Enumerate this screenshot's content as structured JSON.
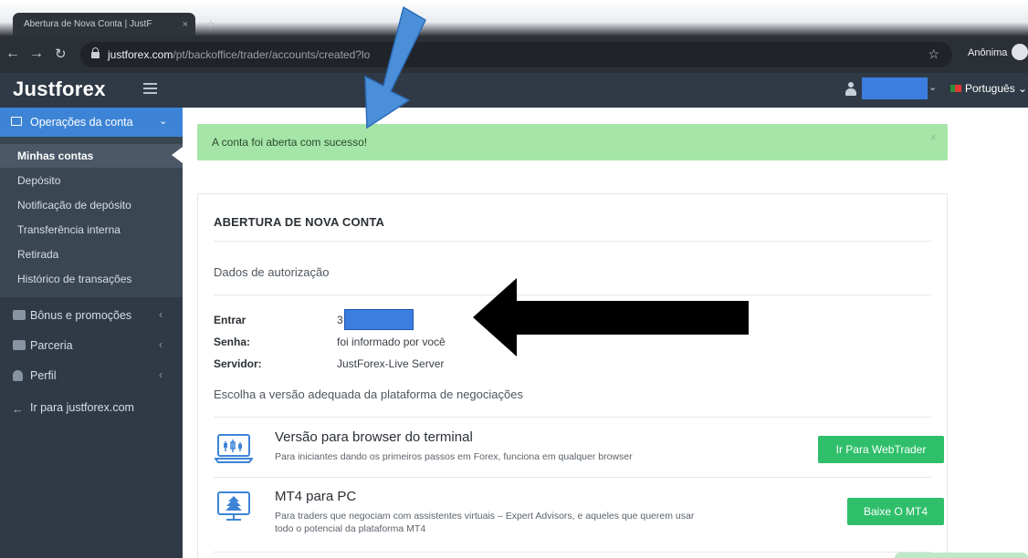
{
  "browser": {
    "tab_title": "Abertura de Nova Conta | JustF",
    "tab_close": "×",
    "new_tab": "+",
    "url_host": "justforex.com",
    "url_path": "/pt/backoffice/trader/accounts/created?lo",
    "incognito_label": "Anônima"
  },
  "header": {
    "logo": "Justforex",
    "language": "Português"
  },
  "sidebar": {
    "section_title": "Operações da conta",
    "sub_items": [
      {
        "label": "Minhas contas"
      },
      {
        "label": "Depósito"
      },
      {
        "label": "Notificação de depósito"
      },
      {
        "label": "Transferência interna"
      },
      {
        "label": "Retirada"
      },
      {
        "label": "Histórico de transações"
      }
    ],
    "groups": [
      {
        "label": "Bônus e promoções"
      },
      {
        "label": "Parceria"
      },
      {
        "label": "Perfil"
      },
      {
        "label": "Ir para justforex.com"
      }
    ]
  },
  "alert": {
    "message": "A conta foi aberta com sucesso!",
    "close": "×"
  },
  "panel": {
    "title": "ABERTURA DE NOVA CONTA",
    "auth_section": "Dados de autorização",
    "fields": [
      {
        "label": "Entrar",
        "value": "3"
      },
      {
        "label": "Senha:",
        "value": "foi informado por você"
      },
      {
        "label": "Servidor:",
        "value": "JustForex-Live Server"
      }
    ],
    "platform_prompt": "Escolha a versão adequada da plataforma de negociações",
    "platforms": [
      {
        "title": "Versão para browser do terminal",
        "description": "Para iniciantes dando os primeiros passos em Forex, funciona em qualquer browser",
        "button": "Ir Para WebTrader"
      },
      {
        "title": "MT4 para PC",
        "description": "Para traders que negociam com assistentes virtuais – Expert Advisors, e aqueles que querem usar todo o potencial da plataforma MT4",
        "button": "Baixe O MT4"
      }
    ]
  },
  "colors": {
    "brand_blue": "#3d84d6",
    "sidebar_bg": "#2f3a46",
    "success_bg": "#a5e6a8",
    "button_green": "#2fbf6a",
    "redaction": "#3c7de0"
  }
}
